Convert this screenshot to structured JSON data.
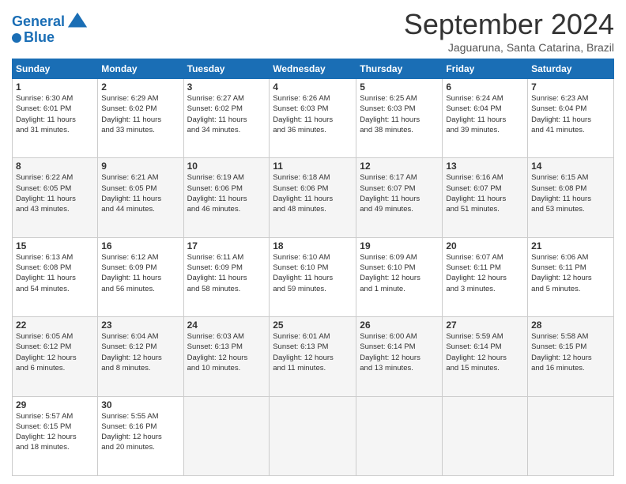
{
  "header": {
    "logo_line1": "General",
    "logo_line2": "Blue",
    "title": "September 2024",
    "location": "Jaguaruna, Santa Catarina, Brazil"
  },
  "columns": [
    "Sunday",
    "Monday",
    "Tuesday",
    "Wednesday",
    "Thursday",
    "Friday",
    "Saturday"
  ],
  "days": [
    {
      "date": "",
      "info": ""
    },
    {
      "date": "",
      "info": ""
    },
    {
      "date": "",
      "info": ""
    },
    {
      "date": "",
      "info": ""
    },
    {
      "date": "",
      "info": ""
    },
    {
      "date": "",
      "info": ""
    },
    {
      "date": "",
      "info": ""
    },
    {
      "date": "1",
      "info": "Sunrise: 6:30 AM\nSunset: 6:01 PM\nDaylight: 11 hours\nand 31 minutes."
    },
    {
      "date": "2",
      "info": "Sunrise: 6:29 AM\nSunset: 6:02 PM\nDaylight: 11 hours\nand 33 minutes."
    },
    {
      "date": "3",
      "info": "Sunrise: 6:27 AM\nSunset: 6:02 PM\nDaylight: 11 hours\nand 34 minutes."
    },
    {
      "date": "4",
      "info": "Sunrise: 6:26 AM\nSunset: 6:03 PM\nDaylight: 11 hours\nand 36 minutes."
    },
    {
      "date": "5",
      "info": "Sunrise: 6:25 AM\nSunset: 6:03 PM\nDaylight: 11 hours\nand 38 minutes."
    },
    {
      "date": "6",
      "info": "Sunrise: 6:24 AM\nSunset: 6:04 PM\nDaylight: 11 hours\nand 39 minutes."
    },
    {
      "date": "7",
      "info": "Sunrise: 6:23 AM\nSunset: 6:04 PM\nDaylight: 11 hours\nand 41 minutes."
    },
    {
      "date": "8",
      "info": "Sunrise: 6:22 AM\nSunset: 6:05 PM\nDaylight: 11 hours\nand 43 minutes."
    },
    {
      "date": "9",
      "info": "Sunrise: 6:21 AM\nSunset: 6:05 PM\nDaylight: 11 hours\nand 44 minutes."
    },
    {
      "date": "10",
      "info": "Sunrise: 6:19 AM\nSunset: 6:06 PM\nDaylight: 11 hours\nand 46 minutes."
    },
    {
      "date": "11",
      "info": "Sunrise: 6:18 AM\nSunset: 6:06 PM\nDaylight: 11 hours\nand 48 minutes."
    },
    {
      "date": "12",
      "info": "Sunrise: 6:17 AM\nSunset: 6:07 PM\nDaylight: 11 hours\nand 49 minutes."
    },
    {
      "date": "13",
      "info": "Sunrise: 6:16 AM\nSunset: 6:07 PM\nDaylight: 11 hours\nand 51 minutes."
    },
    {
      "date": "14",
      "info": "Sunrise: 6:15 AM\nSunset: 6:08 PM\nDaylight: 11 hours\nand 53 minutes."
    },
    {
      "date": "15",
      "info": "Sunrise: 6:13 AM\nSunset: 6:08 PM\nDaylight: 11 hours\nand 54 minutes."
    },
    {
      "date": "16",
      "info": "Sunrise: 6:12 AM\nSunset: 6:09 PM\nDaylight: 11 hours\nand 56 minutes."
    },
    {
      "date": "17",
      "info": "Sunrise: 6:11 AM\nSunset: 6:09 PM\nDaylight: 11 hours\nand 58 minutes."
    },
    {
      "date": "18",
      "info": "Sunrise: 6:10 AM\nSunset: 6:10 PM\nDaylight: 11 hours\nand 59 minutes."
    },
    {
      "date": "19",
      "info": "Sunrise: 6:09 AM\nSunset: 6:10 PM\nDaylight: 12 hours\nand 1 minute."
    },
    {
      "date": "20",
      "info": "Sunrise: 6:07 AM\nSunset: 6:11 PM\nDaylight: 12 hours\nand 3 minutes."
    },
    {
      "date": "21",
      "info": "Sunrise: 6:06 AM\nSunset: 6:11 PM\nDaylight: 12 hours\nand 5 minutes."
    },
    {
      "date": "22",
      "info": "Sunrise: 6:05 AM\nSunset: 6:12 PM\nDaylight: 12 hours\nand 6 minutes."
    },
    {
      "date": "23",
      "info": "Sunrise: 6:04 AM\nSunset: 6:12 PM\nDaylight: 12 hours\nand 8 minutes."
    },
    {
      "date": "24",
      "info": "Sunrise: 6:03 AM\nSunset: 6:13 PM\nDaylight: 12 hours\nand 10 minutes."
    },
    {
      "date": "25",
      "info": "Sunrise: 6:01 AM\nSunset: 6:13 PM\nDaylight: 12 hours\nand 11 minutes."
    },
    {
      "date": "26",
      "info": "Sunrise: 6:00 AM\nSunset: 6:14 PM\nDaylight: 12 hours\nand 13 minutes."
    },
    {
      "date": "27",
      "info": "Sunrise: 5:59 AM\nSunset: 6:14 PM\nDaylight: 12 hours\nand 15 minutes."
    },
    {
      "date": "28",
      "info": "Sunrise: 5:58 AM\nSunset: 6:15 PM\nDaylight: 12 hours\nand 16 minutes."
    },
    {
      "date": "29",
      "info": "Sunrise: 5:57 AM\nSunset: 6:15 PM\nDaylight: 12 hours\nand 18 minutes."
    },
    {
      "date": "30",
      "info": "Sunrise: 5:55 AM\nSunset: 6:16 PM\nDaylight: 12 hours\nand 20 minutes."
    },
    {
      "date": "",
      "info": ""
    },
    {
      "date": "",
      "info": ""
    },
    {
      "date": "",
      "info": ""
    },
    {
      "date": "",
      "info": ""
    },
    {
      "date": "",
      "info": ""
    }
  ]
}
